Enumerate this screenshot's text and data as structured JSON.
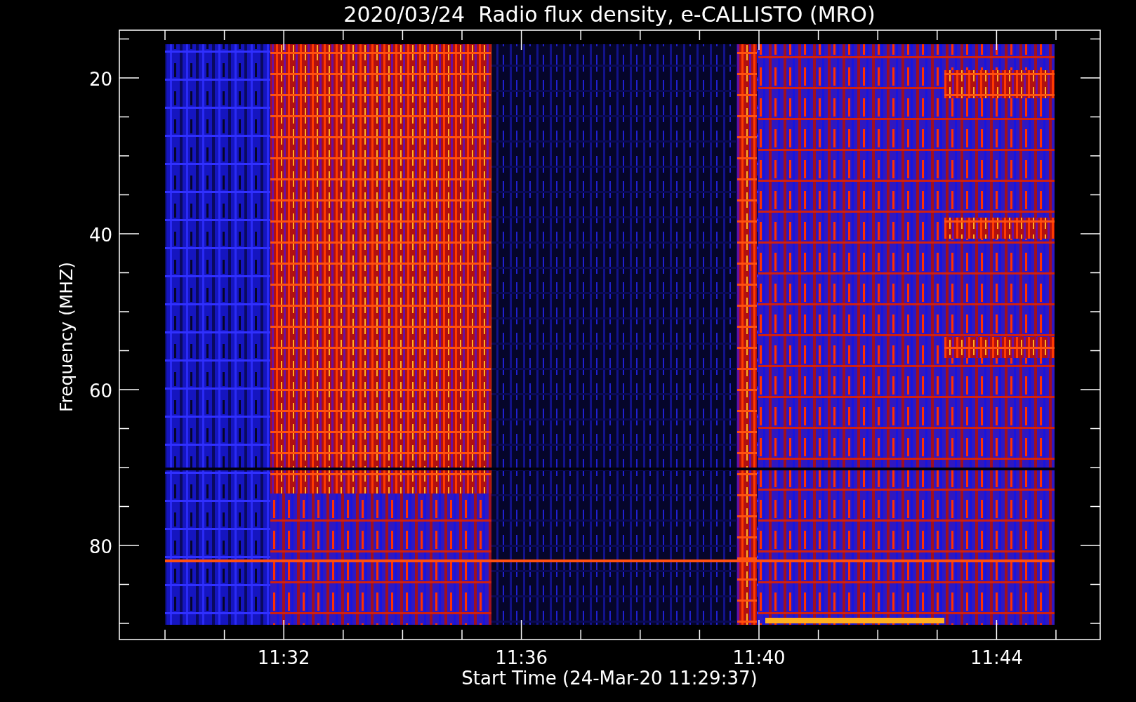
{
  "title": "2020/03/24  Radio flux density, e-CALLISTO (MRO)",
  "y_axis": {
    "label": "Frequency (MHZ)",
    "ticks": [
      "20",
      "40",
      "60",
      "80"
    ]
  },
  "x_axis": {
    "label": "Start Time (24-Mar-20 11:29:37)",
    "ticks": [
      "11:32",
      "11:36",
      "11:40",
      "11:44"
    ]
  }
}
